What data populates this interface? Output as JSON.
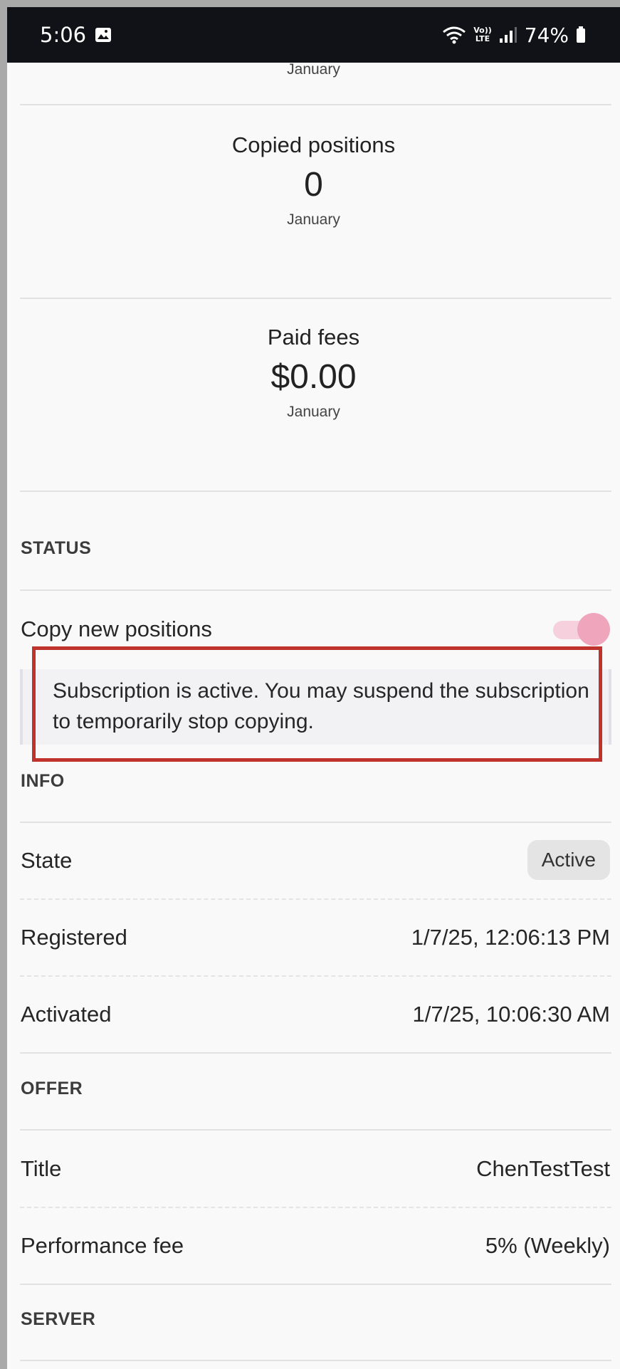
{
  "status_bar": {
    "time": "5:06",
    "battery": "74%",
    "icons": [
      "image-icon",
      "wifi-icon",
      "volte-icon",
      "signal-icon",
      "battery-icon"
    ],
    "volte_top": "Vo))",
    "volte_bottom": "LTE"
  },
  "stats": [
    {
      "label": "",
      "value": "",
      "period": "January"
    },
    {
      "label": "Copied positions",
      "value": "0",
      "period": "January"
    },
    {
      "label": "Paid fees",
      "value": "$0.00",
      "period": "January"
    }
  ],
  "status": {
    "heading": "STATUS",
    "copy_label": "Copy new positions",
    "toggle_on": true,
    "info_text": "Subscription is active. You may suspend the subscription to temporarily stop copying."
  },
  "info": {
    "heading": "INFO",
    "rows": [
      {
        "label": "State",
        "value": "Active"
      },
      {
        "label": "Registered",
        "value": "1/7/25, 12:06:13 PM"
      },
      {
        "label": "Activated",
        "value": "1/7/25, 10:06:30 AM"
      }
    ]
  },
  "offer": {
    "heading": "OFFER",
    "rows": [
      {
        "label": "Title",
        "value": "ChenTestTest"
      },
      {
        "label": "Performance fee",
        "value": "5% (Weekly)"
      }
    ]
  },
  "server": {
    "heading": "SERVER"
  },
  "colors": {
    "status_bar_bg": "#111217",
    "toggle_thumb": "#efa6bc",
    "toggle_track": "#f6d0dc",
    "highlight_border": "#c0332d"
  }
}
